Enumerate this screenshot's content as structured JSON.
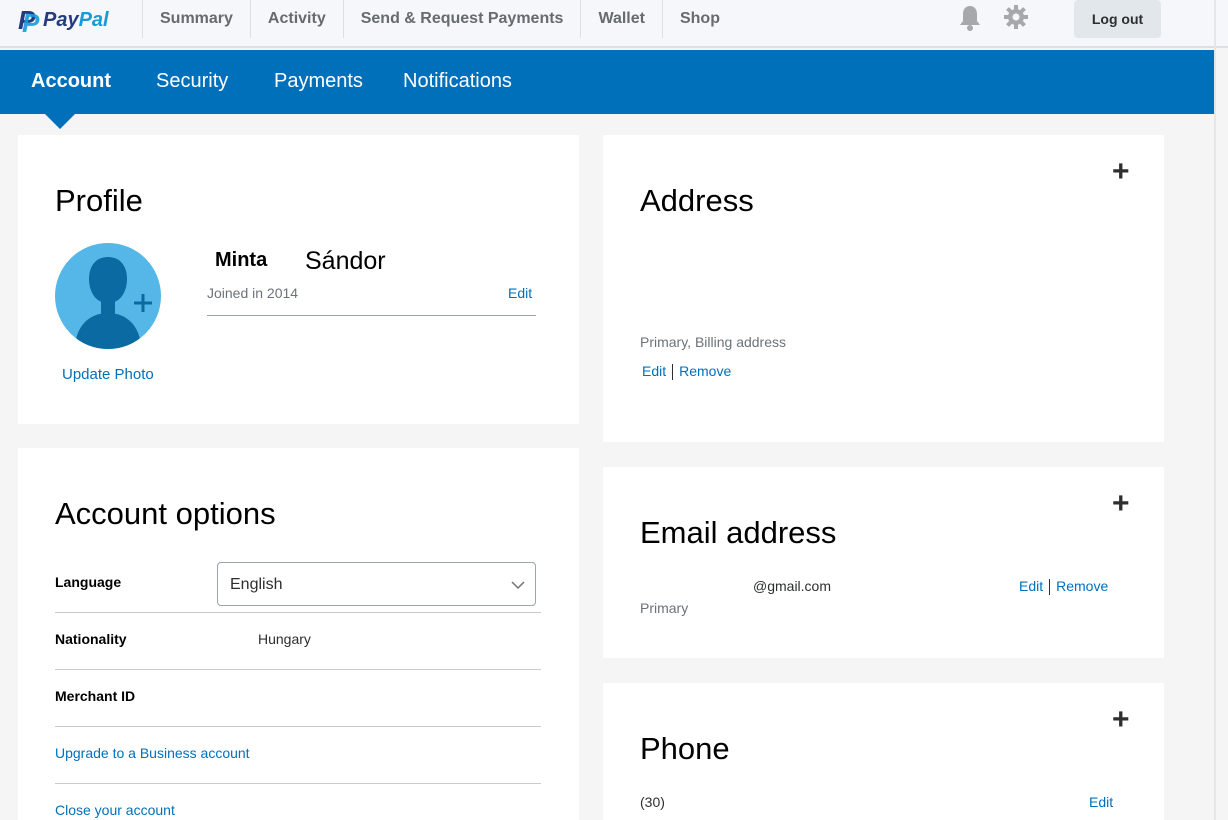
{
  "brand": {
    "logo_text_pay": "Pay",
    "logo_text_pal": "Pal",
    "colors": {
      "primary": "#0070ba",
      "dark_blue": "#253b80",
      "light_blue": "#179bd7"
    }
  },
  "topnav": {
    "items": [
      {
        "label": "Summary"
      },
      {
        "label": "Activity"
      },
      {
        "label": "Send & Request Payments"
      },
      {
        "label": "Wallet"
      },
      {
        "label": "Shop"
      }
    ],
    "icons": [
      "bell-icon",
      "gear-icon"
    ],
    "logout_label": "Log out"
  },
  "subnav": {
    "items": [
      {
        "label": "Account",
        "active": true
      },
      {
        "label": "Security",
        "active": false
      },
      {
        "label": "Payments",
        "active": false
      },
      {
        "label": "Notifications",
        "active": false
      }
    ]
  },
  "profile": {
    "title": "Profile",
    "first_name": "Minta",
    "last_name": "Sándor",
    "joined": "Joined in 2014",
    "edit_label": "Edit",
    "update_photo_label": "Update Photo"
  },
  "account_options": {
    "title": "Account options",
    "language_label": "Language",
    "language_value": "English",
    "nationality_label": "Nationality",
    "nationality_value": "Hungary",
    "merchant_label": "Merchant ID",
    "upgrade_label": "Upgrade to a Business account",
    "close_label": "Close your account"
  },
  "address": {
    "title": "Address",
    "type": "Primary, Billing address",
    "edit_label": "Edit",
    "remove_label": "Remove"
  },
  "email": {
    "title": "Email address",
    "value": "@gmail.com",
    "status": "Primary",
    "edit_label": "Edit",
    "remove_label": "Remove"
  },
  "phone": {
    "title": "Phone",
    "value": "(30)",
    "edit_label": "Edit"
  }
}
